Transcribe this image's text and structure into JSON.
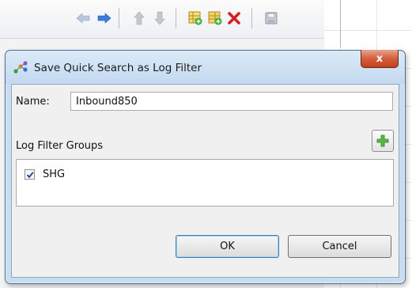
{
  "background_toolbar": {
    "icons": [
      "back-arrow-icon",
      "forward-arrow-icon",
      "up-arrow-icon",
      "down-arrow-icon",
      "add-table-icon",
      "add-row-icon",
      "delete-icon",
      "save-icon"
    ]
  },
  "dialog": {
    "title": "Save Quick Search as Log Filter",
    "close_label": "x",
    "name_label": "Name:",
    "name_value": "Inbound850",
    "groups_label": "Log Filter Groups",
    "groups": [
      {
        "label": "SHG",
        "checked": true
      }
    ],
    "ok_label": "OK",
    "cancel_label": "Cancel"
  },
  "colors": {
    "titlebar": "#c9ddf0",
    "close_button": "#c4401b",
    "add_icon": "#3cae3a",
    "delete_icon": "#d42020",
    "arrow_active": "#2f6fd6"
  }
}
